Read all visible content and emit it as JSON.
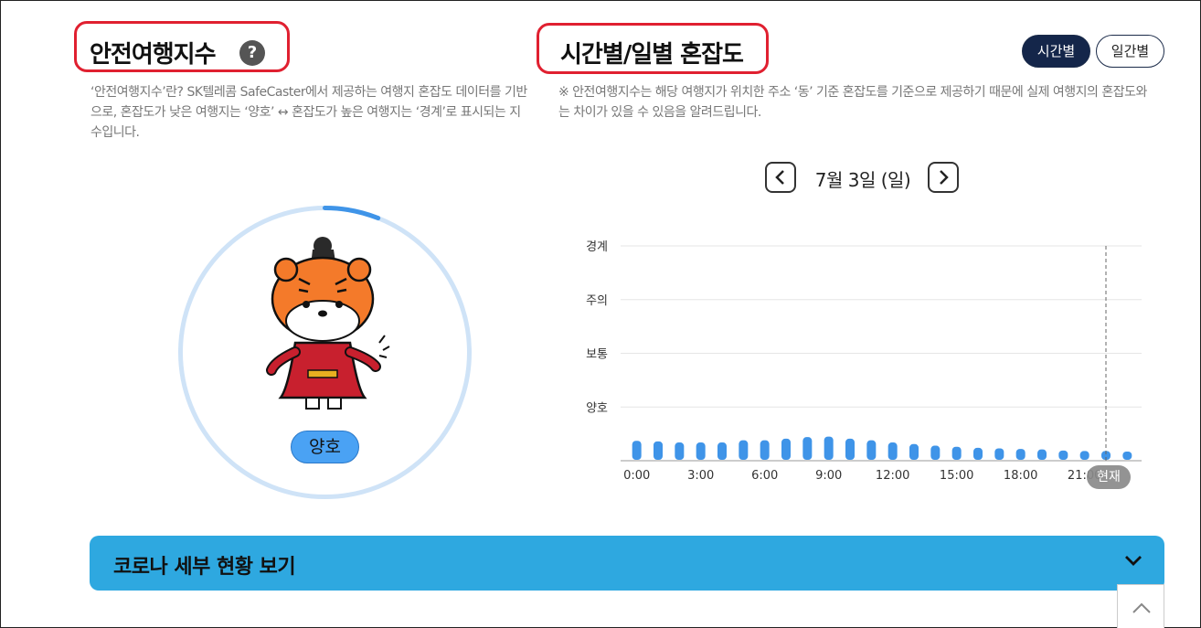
{
  "safety_index": {
    "title": "안전여행지수",
    "help_icon": "question-icon",
    "description": "‘안전여행지수’란? SK텔레콤 SafeCaster에서 제공하는 여행지 혼잡도 데이터를 기반으로, 혼잡도가 낮은 여행지는 ‘양호’ ↔ 혼잡도가 높은 여행지는 ‘경계’로 표시되는 지수입니다.",
    "status": "양호",
    "gauge_level": 0.06,
    "colors": {
      "ring": "#cfe3f7",
      "arc": "#3f94e8",
      "pill": "#4aa2f4"
    }
  },
  "congestion": {
    "title": "시간별/일별 혼잡도",
    "toggle_hour": "시간별",
    "toggle_day": "일간별",
    "notice": "※ 안전여행지수는 해당 여행지가 위치한 주소 ‘동’ 기준 혼잡도를 기준으로 제공하기 때문에 실제 여행지의 혼잡도와는 차이가 있을 수 있음을 알려드립니다.",
    "date": "7월 3일 (일)",
    "now_label": "현재"
  },
  "chart_data": {
    "type": "bar",
    "y_levels": [
      "양호",
      "보통",
      "주의",
      "경계"
    ],
    "x_ticks": [
      "0:00",
      "3:00",
      "6:00",
      "9:00",
      "12:00",
      "15:00",
      "18:00",
      "21:00"
    ],
    "categories": [
      "0",
      "1",
      "2",
      "3",
      "4",
      "5",
      "6",
      "7",
      "8",
      "9",
      "10",
      "11",
      "12",
      "13",
      "14",
      "15",
      "16",
      "17",
      "18",
      "19",
      "20",
      "21",
      "22",
      "23"
    ],
    "values": [
      0.37,
      0.36,
      0.34,
      0.34,
      0.34,
      0.38,
      0.38,
      0.41,
      0.44,
      0.45,
      0.41,
      0.38,
      0.34,
      0.31,
      0.28,
      0.26,
      0.24,
      0.23,
      0.22,
      0.21,
      0.19,
      0.18,
      0.18,
      0.17
    ],
    "ylim": [
      0,
      4
    ],
    "current_index": 22,
    "bar_color": "#3f94e8",
    "grid": true
  },
  "corona": {
    "label": "코로나 세부 현황 보기",
    "chevron_icon": "chevron-down-icon",
    "color": "#2ea8e0"
  },
  "scroll_top_icon": "chevron-up-icon"
}
